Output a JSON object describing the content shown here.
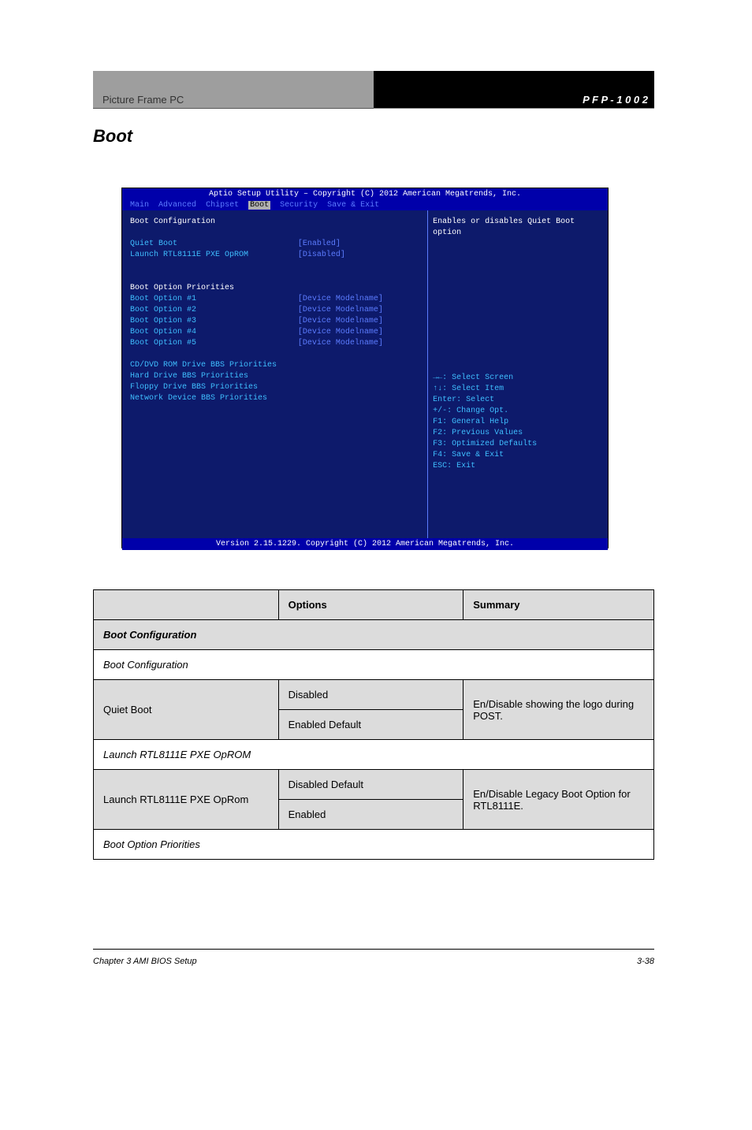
{
  "header": {
    "left": "Picture Frame PC",
    "right": "P F P - 1 0 0 2"
  },
  "section_title": "Boot",
  "bios": {
    "title": "Aptio Setup Utility – Copyright (C) 2012 American Megatrends, Inc.",
    "tabs": [
      "Main",
      "Advanced",
      "Chipset",
      "Boot",
      "Security",
      "Save & Exit"
    ],
    "active_tab": "Boot",
    "left_panel": {
      "heading1": "Boot Configuration",
      "rows1": [
        {
          "label": "Quiet Boot",
          "value": "[Enabled]"
        },
        {
          "label": "Launch RTL8111E PXE OpROM",
          "value": "[Disabled]"
        }
      ],
      "heading2": "Boot Option Priorities",
      "rows2": [
        {
          "label": "Boot Option #1",
          "value": "[Device Modelname]"
        },
        {
          "label": "Boot Option #2",
          "value": "[Device Modelname]"
        },
        {
          "label": "Boot Option #3",
          "value": "[Device Modelname]"
        },
        {
          "label": "Boot Option #4",
          "value": "[Device Modelname]"
        },
        {
          "label": "Boot Option #5",
          "value": "[Device Modelname]"
        }
      ],
      "links": [
        "CD/DVD ROM Drive BBS Priorities",
        "Hard Drive BBS Priorities",
        "Floppy Drive BBS Priorities",
        "Network Device BBS Priorities"
      ]
    },
    "right_panel": {
      "help": "Enables or disables Quiet Boot option",
      "keys": [
        "→←: Select Screen",
        "↑↓: Select Item",
        "Enter: Select",
        "+/-: Change Opt.",
        "F1: General Help",
        "F2: Previous Values",
        "F3: Optimized Defaults",
        "F4: Save & Exit",
        "ESC: Exit"
      ]
    },
    "bottom": "Version 2.15.1229. Copyright (C) 2012 American Megatrends, Inc."
  },
  "table": {
    "headers": [
      "Options",
      "Summary"
    ],
    "subheader": "Boot Configuration",
    "rows": [
      {
        "label": "Quiet Boot",
        "opts": [
          "Disabled",
          "Enabled  Default"
        ],
        "summary": "En/Disable showing the logo during POST."
      }
    ],
    "sub2": "Launch RTL8111E PXE OpROM",
    "rows2": [
      {
        "label": "Launch RTL8111E PXE OpRom",
        "opts": [
          "Disabled  Default",
          "Enabled"
        ],
        "summary": "En/Disable Legacy Boot Option for RTL8111E."
      }
    ],
    "sub3": "Boot Option Priorities"
  },
  "footer": {
    "left": "Chapter 3 AMI BIOS Setup",
    "right": "3-38"
  }
}
